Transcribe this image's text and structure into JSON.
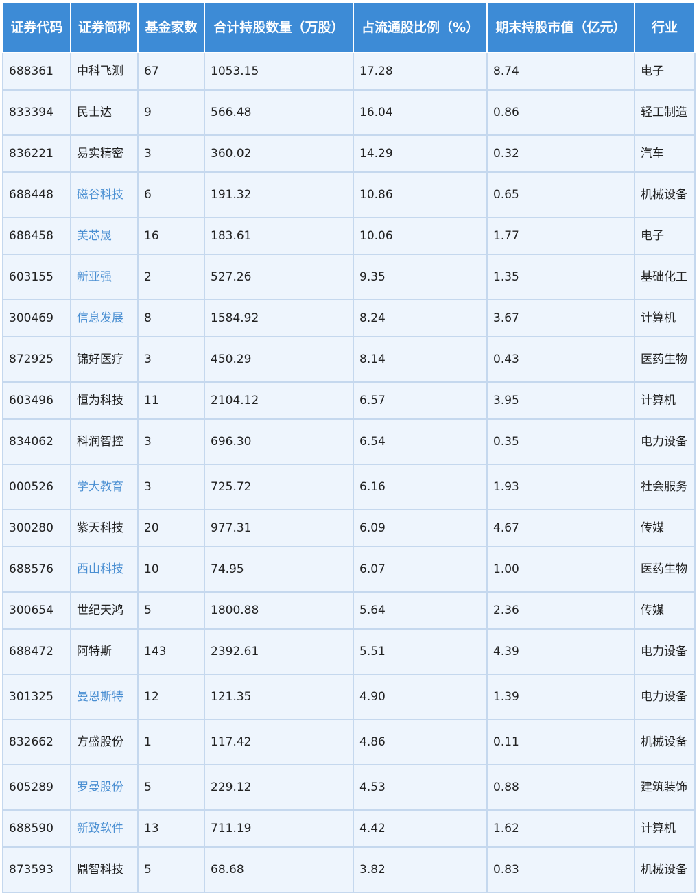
{
  "table": {
    "headers": [
      "证券代码",
      "证券简称",
      "基金家数",
      "合计持股数量（万股）",
      "占流通股比例（%）",
      "期末持股市值（亿元）",
      "行业"
    ],
    "rows": [
      {
        "code": "688361",
        "name": "中科飞测",
        "funds": "67",
        "shares": "1053.15",
        "ratio": "17.28",
        "value": "8.74",
        "industry": "电子",
        "link": false
      },
      {
        "code": "833394",
        "name": "民士达",
        "funds": "9",
        "shares": "566.48",
        "ratio": "16.04",
        "value": "0.86",
        "industry": "轻工制造",
        "link": false
      },
      {
        "code": "836221",
        "name": "易实精密",
        "funds": "3",
        "shares": "360.02",
        "ratio": "14.29",
        "value": "0.32",
        "industry": "汽车",
        "link": false
      },
      {
        "code": "688448",
        "name": "磁谷科技",
        "funds": "6",
        "shares": "191.32",
        "ratio": "10.86",
        "value": "0.65",
        "industry": "机械设备",
        "link": true
      },
      {
        "code": "688458",
        "name": "美芯晟",
        "funds": "16",
        "shares": "183.61",
        "ratio": "10.06",
        "value": "1.77",
        "industry": "电子",
        "link": true
      },
      {
        "code": "603155",
        "name": "新亚强",
        "funds": "2",
        "shares": "527.26",
        "ratio": "9.35",
        "value": "1.35",
        "industry": "基础化工",
        "link": true
      },
      {
        "code": "300469",
        "name": "信息发展",
        "funds": "8",
        "shares": "1584.92",
        "ratio": "8.24",
        "value": "3.67",
        "industry": "计算机",
        "link": true
      },
      {
        "code": "872925",
        "name": "锦好医疗",
        "funds": "3",
        "shares": "450.29",
        "ratio": "8.14",
        "value": "0.43",
        "industry": "医药生物",
        "link": false
      },
      {
        "code": "603496",
        "name": "恒为科技",
        "funds": "11",
        "shares": "2104.12",
        "ratio": "6.57",
        "value": "3.95",
        "industry": "计算机",
        "link": false
      },
      {
        "code": "834062",
        "name": "科润智控",
        "funds": "3",
        "shares": "696.30",
        "ratio": "6.54",
        "value": "0.35",
        "industry": "电力设备",
        "link": false
      },
      {
        "code": "000526",
        "name": "学大教育",
        "funds": "3",
        "shares": "725.72",
        "ratio": "6.16",
        "value": "1.93",
        "industry": "社会服务",
        "link": true
      },
      {
        "code": "300280",
        "name": "紫天科技",
        "funds": "20",
        "shares": "977.31",
        "ratio": "6.09",
        "value": "4.67",
        "industry": "传媒",
        "link": false
      },
      {
        "code": "688576",
        "name": "西山科技",
        "funds": "10",
        "shares": "74.95",
        "ratio": "6.07",
        "value": "1.00",
        "industry": "医药生物",
        "link": true
      },
      {
        "code": "300654",
        "name": "世纪天鸿",
        "funds": "5",
        "shares": "1800.88",
        "ratio": "5.64",
        "value": "2.36",
        "industry": "传媒",
        "link": false
      },
      {
        "code": "688472",
        "name": "阿特斯",
        "funds": "143",
        "shares": "2392.61",
        "ratio": "5.51",
        "value": "4.39",
        "industry": "电力设备",
        "link": false
      },
      {
        "code": "301325",
        "name": "曼恩斯特",
        "funds": "12",
        "shares": "121.35",
        "ratio": "4.90",
        "value": "1.39",
        "industry": "电力设备",
        "link": true
      },
      {
        "code": "832662",
        "name": "方盛股份",
        "funds": "1",
        "shares": "117.42",
        "ratio": "4.86",
        "value": "0.11",
        "industry": "机械设备",
        "link": false
      },
      {
        "code": "605289",
        "name": "罗曼股份",
        "funds": "5",
        "shares": "229.12",
        "ratio": "4.53",
        "value": "0.88",
        "industry": "建筑装饰",
        "link": true
      },
      {
        "code": "688590",
        "name": "新致软件",
        "funds": "13",
        "shares": "711.19",
        "ratio": "4.42",
        "value": "1.62",
        "industry": "计算机",
        "link": true
      },
      {
        "code": "873593",
        "name": "鼎智科技",
        "funds": "5",
        "shares": "68.68",
        "ratio": "3.82",
        "value": "0.83",
        "industry": "机械设备",
        "link": false
      }
    ]
  },
  "colors": {
    "header_bg": "#3d8bd6",
    "cell_bg": "#eef5fd",
    "grid": "#c5d8ee",
    "link": "#4a8fd2"
  }
}
